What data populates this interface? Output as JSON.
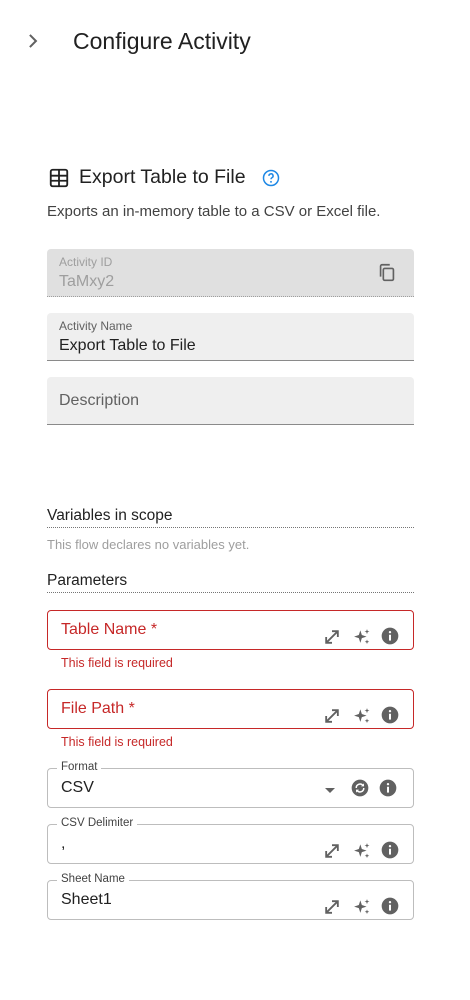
{
  "header": {
    "title": "Configure Activity",
    "expand_icon": "chevron-right-icon"
  },
  "activity": {
    "icon": "table-icon",
    "title": "Export Table to File",
    "help_icon": "help-circle-icon",
    "description": "Exports an in-memory table to a CSV or Excel file."
  },
  "fields": {
    "activity_id": {
      "label": "Activity ID",
      "value": "TaMxy2",
      "copy_icon": "copy-icon"
    },
    "activity_name": {
      "label": "Activity Name",
      "value": "Export Table to File"
    },
    "description": {
      "placeholder": "Description"
    }
  },
  "variables": {
    "title": "Variables in scope",
    "empty_text": "This flow declares no variables yet."
  },
  "parameters": {
    "title": "Parameters",
    "table_name": {
      "placeholder": "Table Name *",
      "error": "This field is required"
    },
    "file_path": {
      "placeholder": "File Path *",
      "error": "This field is required"
    },
    "format": {
      "label": "Format",
      "value": "CSV"
    },
    "csv_delimiter": {
      "label": "CSV Delimiter",
      "value": ","
    },
    "sheet_name": {
      "label": "Sheet Name",
      "value": "Sheet1"
    }
  },
  "colors": {
    "error": "#c62828",
    "help": "#1e88e5",
    "icon": "#616161"
  }
}
